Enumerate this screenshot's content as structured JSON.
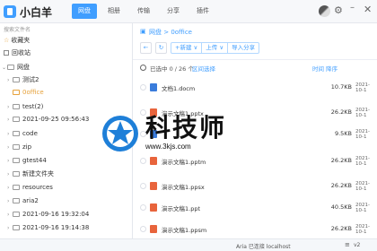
{
  "app": {
    "title": "小白羊"
  },
  "nav": {
    "tabs": [
      {
        "label": "网盘",
        "active": true
      },
      {
        "label": "相册"
      },
      {
        "label": "传输"
      },
      {
        "label": "分享"
      },
      {
        "label": "插件"
      }
    ]
  },
  "sidebar": {
    "search_text": "搜索文件名",
    "items": [
      {
        "label": "收藏夹",
        "icon": "star-icon"
      },
      {
        "label": "回收站",
        "icon": "trash-icon"
      },
      {
        "label": "网盘",
        "icon": "folder-icon"
      },
      {
        "label": "测试2",
        "icon": "folder-icon"
      },
      {
        "label": "0office",
        "icon": "folder-icon",
        "selected": true
      },
      {
        "label": "test(2)",
        "icon": "folder-icon"
      },
      {
        "label": "2021-09-25 09:56:43",
        "icon": "folder-icon"
      },
      {
        "label": "code",
        "icon": "folder-icon"
      },
      {
        "label": "zip",
        "icon": "folder-icon"
      },
      {
        "label": "gtest44",
        "icon": "folder-icon"
      },
      {
        "label": "新建文件夹",
        "icon": "folder-icon"
      },
      {
        "label": "resources",
        "icon": "folder-icon"
      },
      {
        "label": "aria2",
        "icon": "folder-icon"
      },
      {
        "label": "2021-09-16 19:32:04",
        "icon": "folder-icon"
      },
      {
        "label": "2021-09-16 19:14:38",
        "icon": "folder-icon"
      }
    ]
  },
  "main": {
    "breadcrumb": "网盘 > 0office",
    "toolbar": {
      "new_label": "+新建 ∨",
      "upload_label": "上传 ∨",
      "import_label": "导入分享"
    },
    "list_header": {
      "selected": "已选中 0 / 26 个",
      "range_select": "区间选择",
      "sort": "时间 降序"
    },
    "files": [
      {
        "name": "文档1.docm",
        "type": "doc",
        "size": "10.7KB",
        "date": "2021-10-1"
      },
      {
        "name": "演示文稿1.pptx",
        "type": "ppt",
        "size": "26.2KB",
        "date": "2021-10-1"
      },
      {
        "name": "",
        "type": "doc",
        "size": "9.5KB",
        "date": "2021-10-1"
      },
      {
        "name": "演示文稿1.pptm",
        "type": "ppt",
        "size": "26.2KB",
        "date": "2021-10-1"
      },
      {
        "name": "演示文稿1.ppsx",
        "type": "ppt",
        "size": "26.2KB",
        "date": "2021-10-1"
      },
      {
        "name": "演示文稿1.ppt",
        "type": "ppt",
        "size": "40.5KB",
        "date": "2021-10-1"
      },
      {
        "name": "演示文稿1.ppsm",
        "type": "ppt",
        "size": "26.2KB",
        "date": "2021-10-1"
      }
    ]
  },
  "watermark": {
    "title": "科技师",
    "url": "www.3kjs.com"
  },
  "status": {
    "text": "Aria 已连接 localhost",
    "version": "v2"
  },
  "colors": {
    "accent": "#409eff",
    "ppt": "#e8643c",
    "doc": "#3a7cdb",
    "selected": "#e6a23c"
  }
}
